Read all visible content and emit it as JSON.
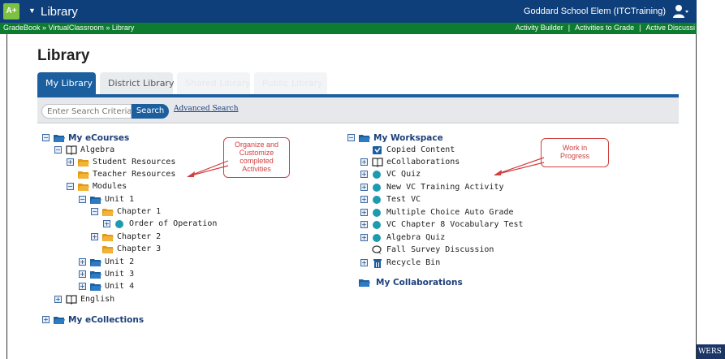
{
  "topbar": {
    "logo": "A+",
    "title": "Library",
    "school": "Goddard School Elem (ITCTraining)"
  },
  "greenbar": {
    "breadcrumb": "GradeBook » VirtualClassroom » Library",
    "links": [
      "Activity Builder",
      "Activities to Grade",
      "Active Discussi"
    ]
  },
  "page": {
    "title": "Library"
  },
  "tabs": {
    "my_library": "My Library",
    "district_library": "District Library",
    "faded_1": "Shared Library",
    "faded_2": "Public Library"
  },
  "search": {
    "placeholder": "Enter Search Criteria",
    "button": "Search",
    "advanced": "Advanced Search"
  },
  "left_tree": {
    "my_ecourses": "My eCourses",
    "algebra": "Algebra",
    "student_resources": "Student Resources",
    "teacher_resources": "Teacher Resources",
    "modules": "Modules",
    "unit1": "Unit 1",
    "chapter1": "Chapter 1",
    "order_of_operation": "Order of Operation",
    "chapter2": "Chapter 2",
    "chapter3": "Chapter 3",
    "unit2": "Unit 2",
    "unit3": "Unit 3",
    "unit4": "Unit 4",
    "english": "English",
    "my_ecollections": "My eCollections"
  },
  "right_tree": {
    "my_workspace": "My Workspace",
    "copied_content": "Copied Content",
    "ecollaborations": "eCollaborations",
    "vc_quiz": "VC Quiz",
    "new_vc_training": "New VC Training Activity",
    "test_vc": "Test VC",
    "multiple_choice": "Multiple Choice Auto Grade",
    "vc_chapter8": "VC Chapter 8 Vocabulary Test",
    "algebra_quiz": "Algebra Quiz",
    "fall_survey": "Fall Survey Discussion",
    "recycle_bin": "Recycle Bin",
    "my_collaborations": "My Collaborations"
  },
  "callouts": {
    "organize_1": "Organize and",
    "organize_2": "Customize",
    "organize_3": "completed",
    "organize_4": "Activities",
    "work_1": "Work in",
    "work_2": "Progress"
  },
  "brand": "WERS",
  "colors": {
    "topbar": "#0f3f7a",
    "greenbar": "#0e7c2f",
    "accent": "#1c5f9f",
    "folder": "#f5a623",
    "callout": "#d04040"
  }
}
